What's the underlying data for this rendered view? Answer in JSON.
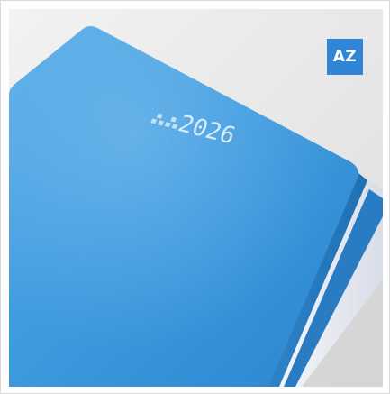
{
  "product": {
    "cover_year": "2026",
    "badge_label": "AZ"
  },
  "colors": {
    "cover_blue": "#3a97dc",
    "badge_blue": "#2f86d6",
    "background": "#e9e9e9"
  }
}
